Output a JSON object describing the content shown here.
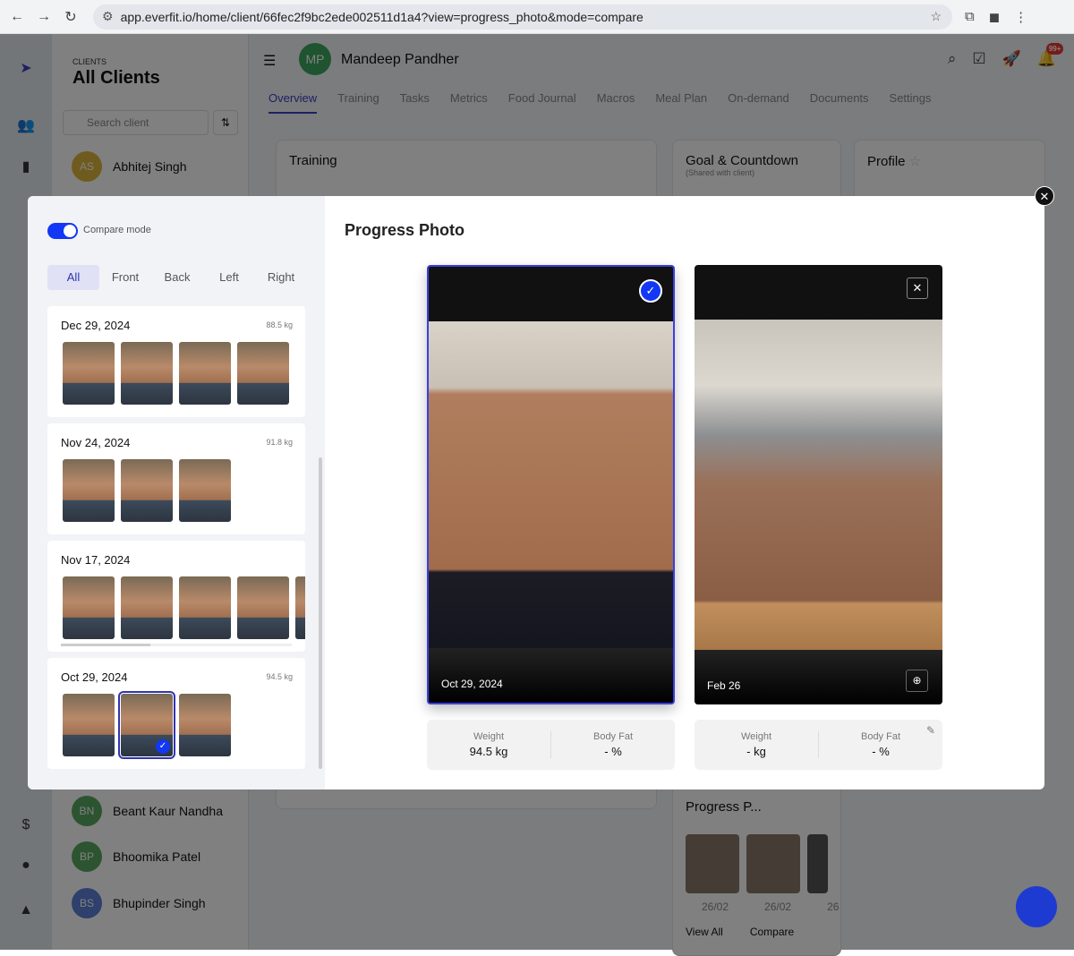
{
  "browser": {
    "url": "app.everfit.io/home/client/66fec2f9bc2ede002511d1a4?view=progress_photo&mode=compare"
  },
  "clients": {
    "label": "CLIENTS",
    "title": "All Clients",
    "search_placeholder": "Search client",
    "items": [
      {
        "initials": "AS",
        "name": "Abhitej Singh",
        "color": "#e0b63c"
      },
      {
        "initials": "BN",
        "name": "Beant Kaur Nandha",
        "color": "#5aa860"
      },
      {
        "initials": "BP",
        "name": "Bhoomika Patel",
        "color": "#5aa860"
      },
      {
        "initials": "BS",
        "name": "Bhupinder Singh",
        "color": "#5b7fd6"
      }
    ]
  },
  "header": {
    "initials": "MP",
    "name": "Mandeep Pandher",
    "notif_badge": "99+"
  },
  "tabs": [
    "Overview",
    "Training",
    "Tasks",
    "Metrics",
    "Food Journal",
    "Macros",
    "Meal Plan",
    "On-demand",
    "Documents",
    "Settings"
  ],
  "cards": {
    "training": "Training",
    "goal": "Goal & Countdown",
    "goal_sub": "(Shared with client)",
    "profile": "Profile",
    "progress": "Progress P...",
    "thumb_dates": [
      "26/02",
      "26/02",
      "26"
    ],
    "view_all": "View All",
    "compare": "Compare"
  },
  "modal": {
    "compare_mode_label": "Compare mode",
    "compare_mode_on": true,
    "filters": [
      "All",
      "Front",
      "Back",
      "Left",
      "Right"
    ],
    "active_filter": "All",
    "groups": [
      {
        "date": "Dec 29, 2024",
        "weight": "88.5 kg",
        "photos": 4
      },
      {
        "date": "Nov 24, 2024",
        "weight": "91.8 kg",
        "photos": 3
      },
      {
        "date": "Nov 17, 2024",
        "weight": "",
        "photos": 5
      },
      {
        "date": "Oct 29, 2024",
        "weight": "94.5 kg",
        "photos": 3
      }
    ],
    "title": "Progress Photo",
    "left_photo": {
      "date": "Oct 29, 2024",
      "weight_label": "Weight",
      "weight": "94.5 kg",
      "bodyfat_label": "Body Fat",
      "bodyfat": "- %"
    },
    "right_photo": {
      "date": "Feb 26",
      "weight_label": "Weight",
      "weight": "- kg",
      "bodyfat_label": "Body Fat",
      "bodyfat": "- %"
    }
  }
}
